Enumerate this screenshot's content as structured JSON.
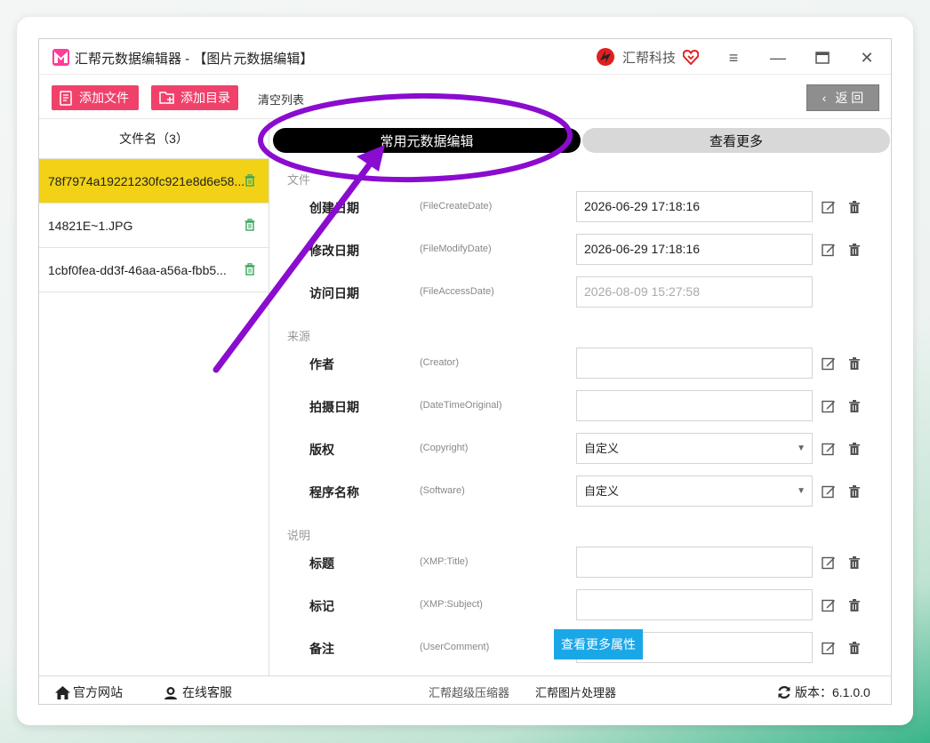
{
  "app": {
    "title": "汇帮元数据编辑器 - 【图片元数据编辑】",
    "brand": "汇帮科技",
    "accent": "#f0416b",
    "highlight": "#f2d216"
  },
  "toolbar": {
    "add_file": "添加文件",
    "add_dir": "添加目录",
    "clear": "清空列表",
    "back": "返 回"
  },
  "file_list": {
    "header": "文件名（3）",
    "items": [
      {
        "name": "78f7974a19221230fc921e8d6e58..."
      },
      {
        "name": "14821E~1.JPG"
      },
      {
        "name": "1cbf0fea-dd3f-46aa-a56a-fbb5..."
      }
    ]
  },
  "tabs": {
    "common": "常用元数据编辑",
    "more": "查看更多"
  },
  "sections": {
    "file": "文件",
    "source": "来源",
    "desc": "说明"
  },
  "fields": {
    "create": {
      "label": "创建日期",
      "key": "(FileCreateDate)",
      "value": "2026-06-29 17:18:16"
    },
    "modify": {
      "label": "修改日期",
      "key": "(FileModifyDate)",
      "value": "2026-06-29 17:18:16"
    },
    "access": {
      "label": "访问日期",
      "key": "(FileAccessDate)",
      "value": "2026-08-09 15:27:58"
    },
    "creator": {
      "label": "作者",
      "key": "(Creator)",
      "value": ""
    },
    "datetime": {
      "label": "拍摄日期",
      "key": "(DateTimeOriginal)",
      "value": ""
    },
    "copyright": {
      "label": "版权",
      "key": "(Copyright)",
      "value": "自定义"
    },
    "software": {
      "label": "程序名称",
      "key": "(Software)",
      "value": "自定义"
    },
    "title": {
      "label": "标题",
      "key": "(XMP:Title)",
      "value": ""
    },
    "subject": {
      "label": "标记",
      "key": "(XMP:Subject)",
      "value": ""
    },
    "comment": {
      "label": "备注",
      "key": "(UserComment)",
      "value": ""
    }
  },
  "more_props_button": "查看更多属性",
  "footer": {
    "website": "官方网站",
    "service": "在线客服",
    "compressor": "汇帮超级压缩器",
    "image_tool": "汇帮图片处理器",
    "version_label": "版本：",
    "version": "6.1.0.0"
  },
  "annotation_color": "#8a0ccf"
}
